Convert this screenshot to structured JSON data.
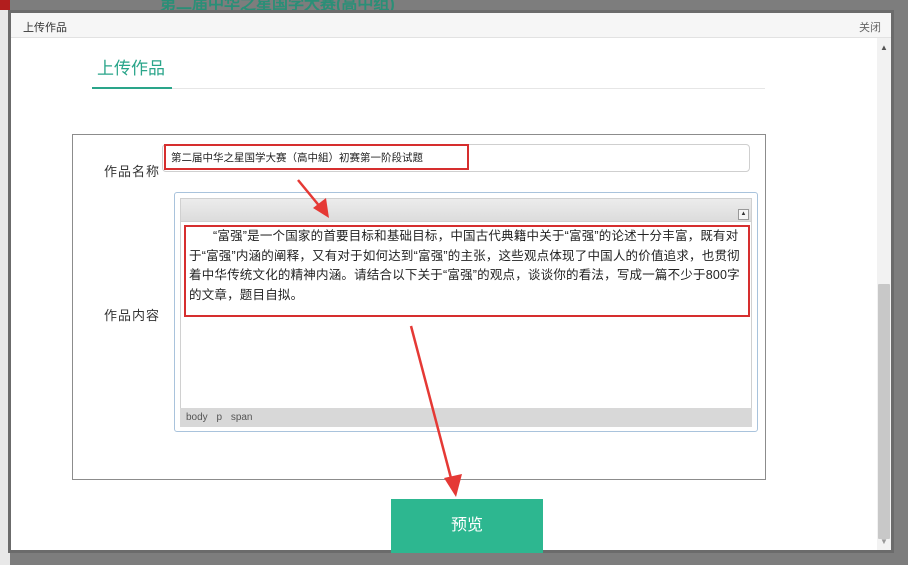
{
  "background": {
    "top_text": "第二届中华之星国学大赛(高中组)"
  },
  "dialog": {
    "title": "上传作品",
    "close_label": "关闭"
  },
  "section": {
    "title": "上传作品"
  },
  "form": {
    "name_label": "作品名称",
    "name_value": "第二届中华之星国学大赛（高中組）初赛第一阶段试题",
    "content_label": "作品内容",
    "content_text": "“富强”是一个国家的首要目标和基础目标，中国古代典籍中关于“富强”的论述十分丰富，既有对于“富强”内涵的阐释，又有对于如何达到“富强”的主张，这些观点体现了中国人的价值追求，也贯彻着中华传统文化的精神内涵。请结合以下关于“富强”的观点，谈谈你的看法，写成一篇不少于800字的文章，题目自拟。",
    "statusbar_path": [
      "body",
      "p",
      "span"
    ]
  },
  "preview_button_label": "预览",
  "colors": {
    "accent": "#2aa58a",
    "button": "#2db790",
    "highlight": "#d62e2e"
  }
}
